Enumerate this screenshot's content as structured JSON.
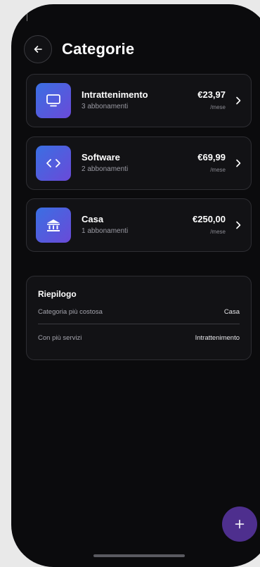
{
  "header": {
    "title": "Categorie"
  },
  "categories": [
    {
      "name": "Intrattenimento",
      "count": "3 abbonamenti",
      "price": "€23,97",
      "unit": "/mese",
      "icon": "tv-icon"
    },
    {
      "name": "Software",
      "count": "2 abbonamenti",
      "price": "€69,99",
      "unit": "/mese",
      "icon": "code-icon"
    },
    {
      "name": "Casa",
      "count": "1 abbonamenti",
      "price": "€250,00",
      "unit": "/mese",
      "icon": "bank-icon"
    }
  ],
  "summary": {
    "title": "Riepilogo",
    "rows": [
      {
        "label": "Categoria più costosa",
        "value": "Casa"
      },
      {
        "label": "Con più servizi",
        "value": "Intrattenimento"
      }
    ]
  },
  "fab": {
    "label": "+"
  },
  "colors": {
    "background": "#0b0b0d",
    "card": "#121215",
    "accent": "#4e2f8e",
    "icon_gradient_start": "#3a6fe3",
    "icon_gradient_end": "#6a4ad8"
  }
}
